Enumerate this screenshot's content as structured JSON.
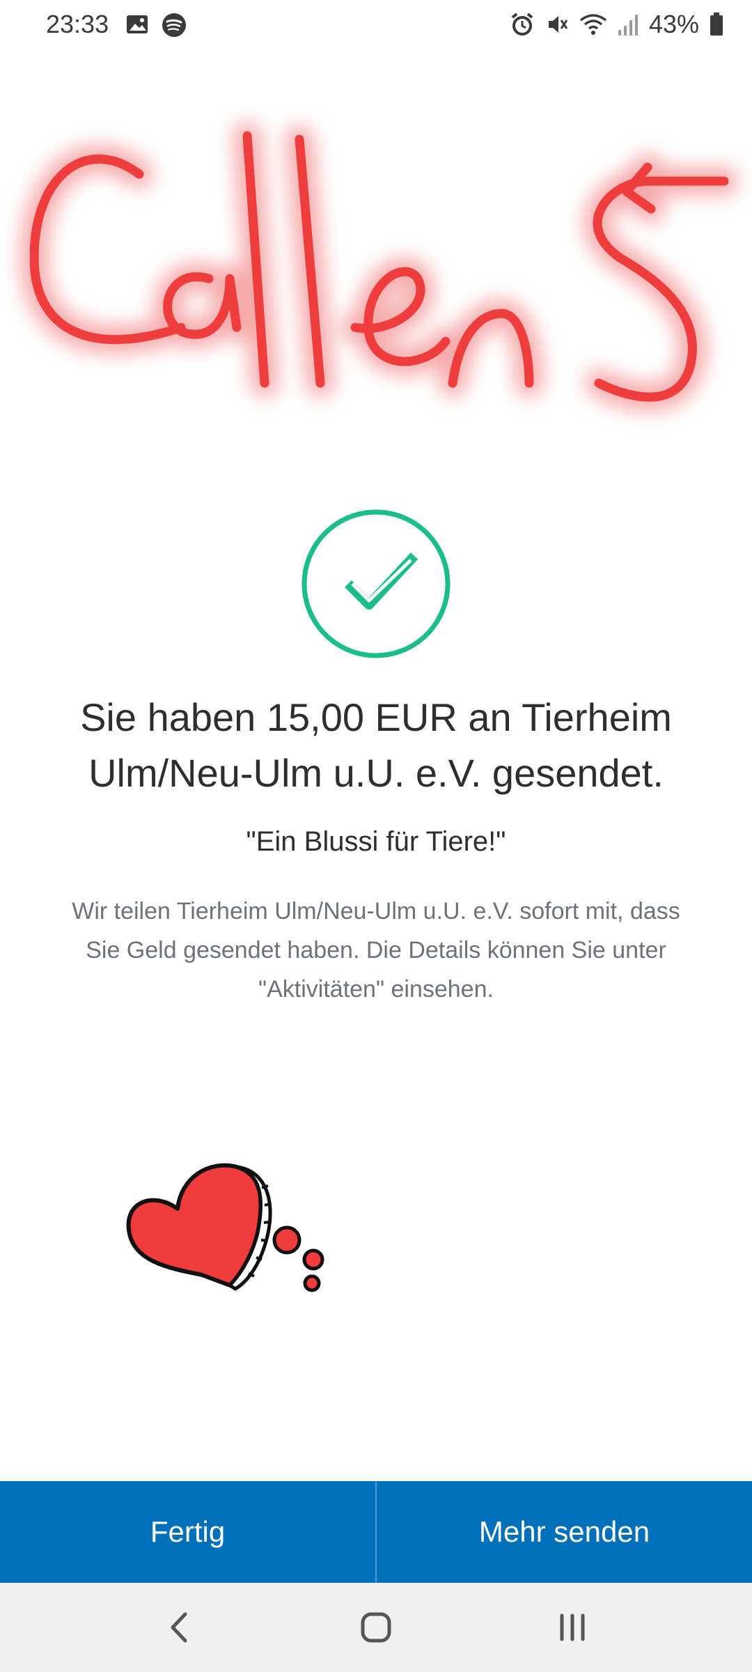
{
  "status_bar": {
    "time": "23:33",
    "battery_percent": "43%",
    "left_icons": [
      "gallery-icon",
      "spotify-icon"
    ],
    "right_icons": [
      "alarm-icon",
      "mute-icon",
      "wifi-icon",
      "signal-icon",
      "battery-icon"
    ]
  },
  "signature": {
    "text": "Callens",
    "color": "#e83a3a"
  },
  "confirmation": {
    "icon": "check-circle-icon",
    "accent_color": "#1bbd8a",
    "headline": "Sie haben 15,00 EUR an Tierheim Ulm/Neu-Ulm u.U. e.V. gesendet.",
    "note": "\"Ein Blussi für Tiere!\"",
    "info": "Wir teilen Tierheim Ulm/Neu-Ulm u.U. e.V. sofort mit, dass Sie Geld gesendet haben. Die Details können Sie unter \"Aktivitäten\" einsehen."
  },
  "sticker": {
    "icon": "heart-sticker-icon",
    "color": "#f03c3c"
  },
  "actions": {
    "done_label": "Fertig",
    "send_more_label": "Mehr senden",
    "bar_color": "#0070ba"
  },
  "nav_bar": {
    "icons": [
      "back-icon",
      "home-icon",
      "recent-apps-icon"
    ]
  }
}
